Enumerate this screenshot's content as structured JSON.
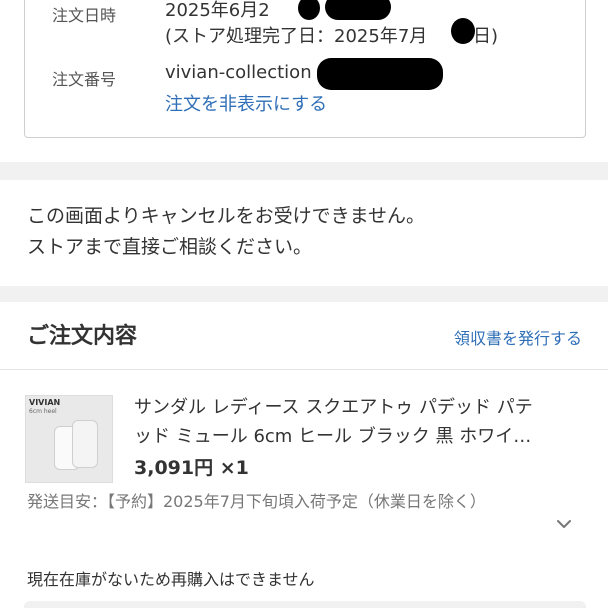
{
  "order": {
    "date_label": "注文日時",
    "date_value": "2025年6月2",
    "store_done": "(ストア処理完了日：2025年7月",
    "store_done_tail": "日)",
    "number_label": "注文番号",
    "number_value": "vivian-collection",
    "hide_link": "注文を非表示にする"
  },
  "notice": {
    "line1": "この画面よりキャンセルをお受けできません。",
    "line2": "ストアまで直接ご相談ください。"
  },
  "section": {
    "title": "ご注文内容",
    "receipt_link": "領収書を発行する"
  },
  "product": {
    "thumb_brand": "VIVIAN",
    "thumb_sub": "6cm heel",
    "title_line1": "サンダル レディース スクエアトゥ パデッド パテ",
    "title_line2": "ッド ミュール 6cm ヒール ブラック 黒 ホワイ…",
    "price": "3,091円 ×1"
  },
  "shipping": {
    "text": "発送目安：【予約】2025年7月下旬頃入荷予定（休業日を除く）"
  },
  "stock_note": "現在在庫がないため再購入はできません",
  "colors": {
    "link": "#2f6fb7",
    "gap": "#f1f1f1"
  },
  "icons": {
    "expand": "chevron-down-icon"
  }
}
